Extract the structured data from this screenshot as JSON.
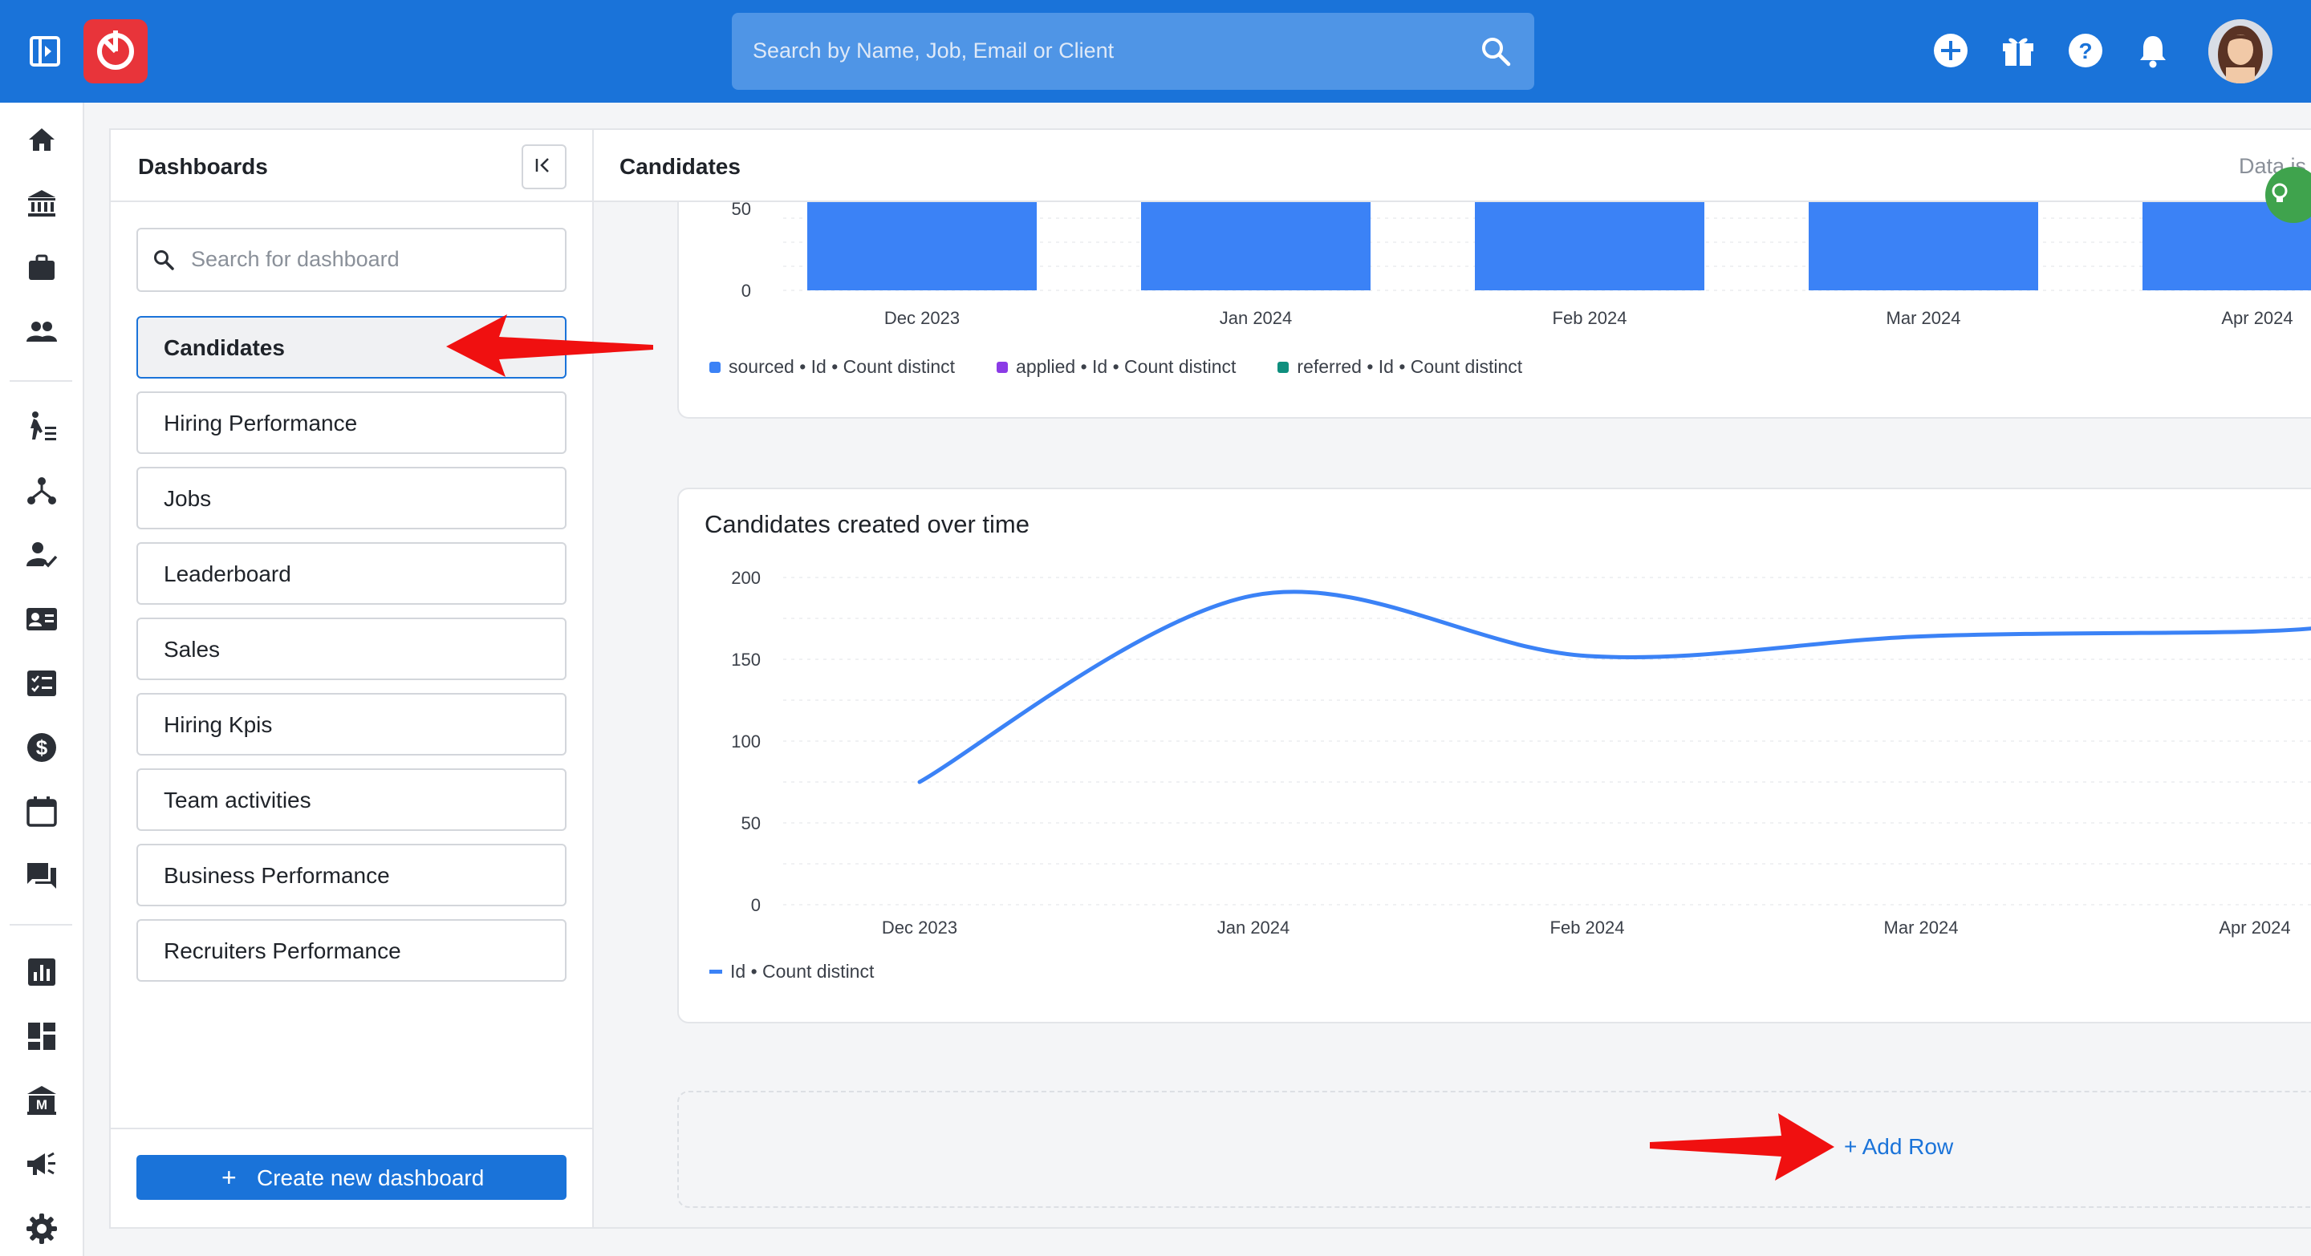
{
  "topbar": {
    "search_placeholder": "Search by Name, Job, Email or Client",
    "icons": [
      "sidebar-toggle-icon",
      "logo-icon",
      "search-icon",
      "add-circle-icon",
      "gift-icon",
      "help-icon",
      "bell-icon"
    ]
  },
  "rail": {
    "items": [
      "home",
      "clients",
      "jobs",
      "contacts",
      "pipeline",
      "org",
      "tasks-people",
      "contact-card",
      "checklist",
      "billing",
      "calendar",
      "messages",
      "reports",
      "dashboards",
      "company",
      "announcements",
      "settings"
    ]
  },
  "dashboards_panel": {
    "title": "Dashboards",
    "search_placeholder": "Search for dashboard",
    "items": [
      {
        "label": "Candidates",
        "active": true
      },
      {
        "label": "Hiring Performance",
        "active": false
      },
      {
        "label": "Jobs",
        "active": false
      },
      {
        "label": "Leaderboard",
        "active": false
      },
      {
        "label": "Sales",
        "active": false
      },
      {
        "label": "Hiring Kpis",
        "active": false
      },
      {
        "label": "Team activities",
        "active": false
      },
      {
        "label": "Business Performance",
        "active": false
      },
      {
        "label": "Recruiters Performance",
        "active": false
      }
    ],
    "create_button": "Create new dashboard",
    "create_icon": "+"
  },
  "main": {
    "title": "Candidates",
    "right_text": "Data is",
    "add_row": "+ Add Row"
  },
  "colors": {
    "primary": "#1a73d9",
    "sourced": "#3b82f6",
    "applied": "#8b3be6",
    "referred": "#0f8f7e",
    "annotation_arrow": "#f01010"
  },
  "chart_data": [
    {
      "type": "bar",
      "categories": [
        "Dec 2023",
        "Jan 2024",
        "Feb 2024",
        "Mar 2024",
        "Apr 2024"
      ],
      "y_ticks": [
        "50",
        "0"
      ],
      "series": [
        {
          "name": "sourced • Id • Count distinct",
          "values": [
            60,
            60,
            60,
            60,
            60
          ],
          "color": "#3b82f6"
        },
        {
          "name": "applied • Id • Count distinct",
          "values": [
            0,
            0,
            0,
            0,
            0
          ],
          "color": "#8b3be6"
        },
        {
          "name": "referred • Id • Count distinct",
          "values": [
            0,
            0,
            0,
            0,
            0
          ],
          "color": "#0f8f7e"
        }
      ],
      "legend": "bottom-left",
      "grid": true
    },
    {
      "type": "line",
      "title": "Candidates created over time",
      "categories": [
        "Dec 2023",
        "Jan 2024",
        "Feb 2024",
        "Mar 2024",
        "Apr 2024"
      ],
      "x": [
        0,
        1,
        2,
        3,
        4
      ],
      "y_ticks": [
        "200",
        "150",
        "100",
        "50",
        "0"
      ],
      "ylim": [
        0,
        200
      ],
      "series": [
        {
          "name": "Id • Count distinct",
          "x": [
            0,
            1,
            2,
            3,
            4,
            4.3
          ],
          "values": [
            75,
            189,
            152,
            164,
            167,
            172
          ],
          "color": "#3b82f6"
        }
      ],
      "legend": "bottom-left",
      "grid": true
    }
  ]
}
